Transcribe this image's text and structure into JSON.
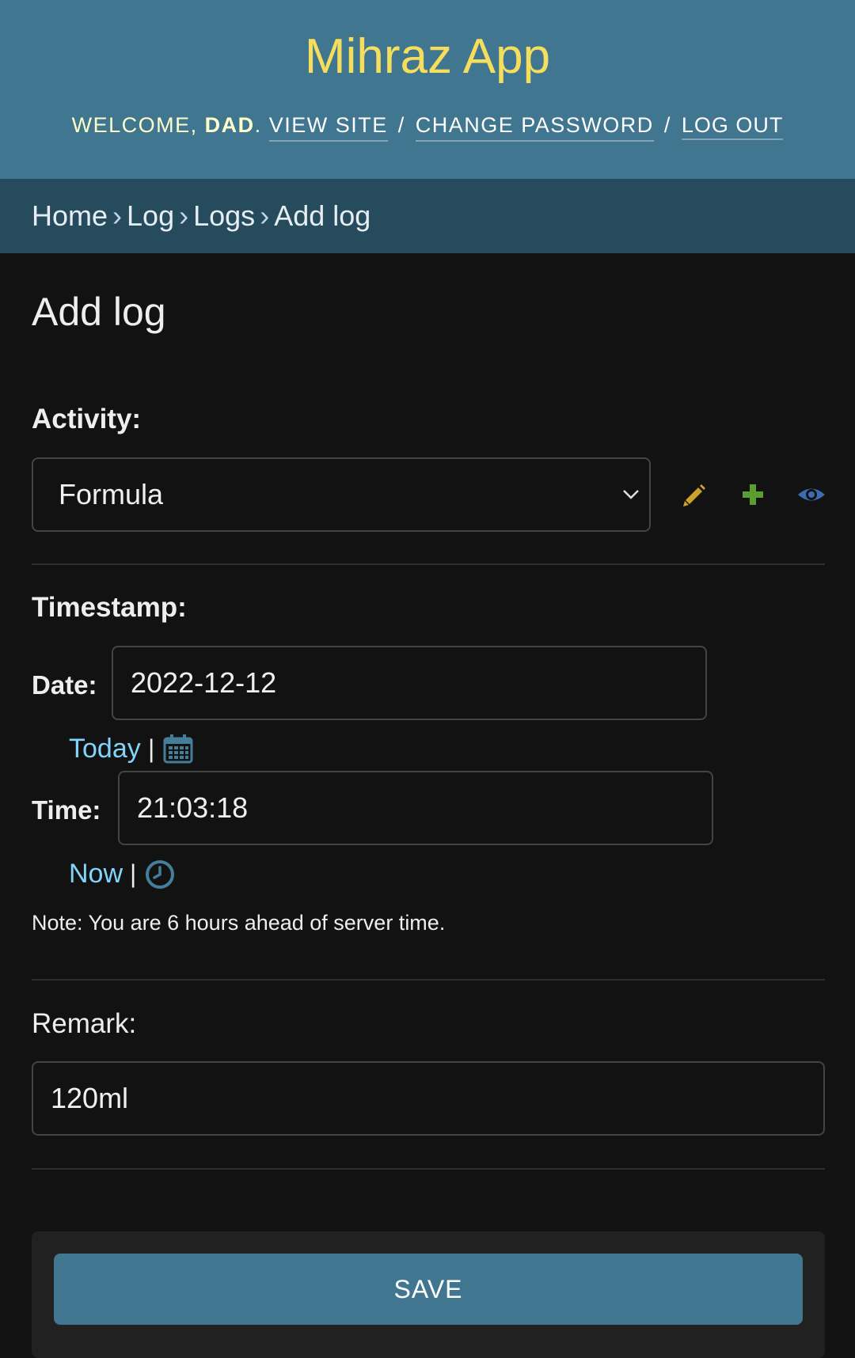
{
  "header": {
    "site_title": "Mihraz App",
    "welcome_prefix": "Welcome,",
    "user_name": "dad",
    "view_site": "View site",
    "change_password": "Change password",
    "log_out": "Log out"
  },
  "breadcrumbs": {
    "items": [
      "Home",
      "Log",
      "Logs",
      "Add log"
    ]
  },
  "page": {
    "title": "Add log"
  },
  "form": {
    "activity": {
      "label": "Activity:",
      "selected_value": "Formula"
    },
    "timestamp": {
      "label": "Timestamp:",
      "date_label": "Date:",
      "date_value": "2022-12-12",
      "today_link": "Today",
      "time_label": "Time:",
      "time_value": "21:03:18",
      "now_link": "Now",
      "separator": "|",
      "note": "Note: You are 6 hours ahead of server time."
    },
    "remark": {
      "label": "Remark:",
      "value": "120ml"
    },
    "save_label": "SAVE"
  },
  "colors": {
    "header_bg": "#417690",
    "breadcrumbs_bg": "#264b5d",
    "title_yellow": "#f5dd5d",
    "link_blue": "#81d4fa",
    "edit_icon": "#c9a227",
    "add_icon": "#5a9e2f",
    "view_icon": "#3b6db3"
  },
  "icons": {
    "edit": "pencil-icon",
    "add": "plus-icon",
    "view": "eye-icon",
    "calendar": "calendar-icon",
    "clock": "clock-icon",
    "dropdown": "chevron-down-icon"
  }
}
